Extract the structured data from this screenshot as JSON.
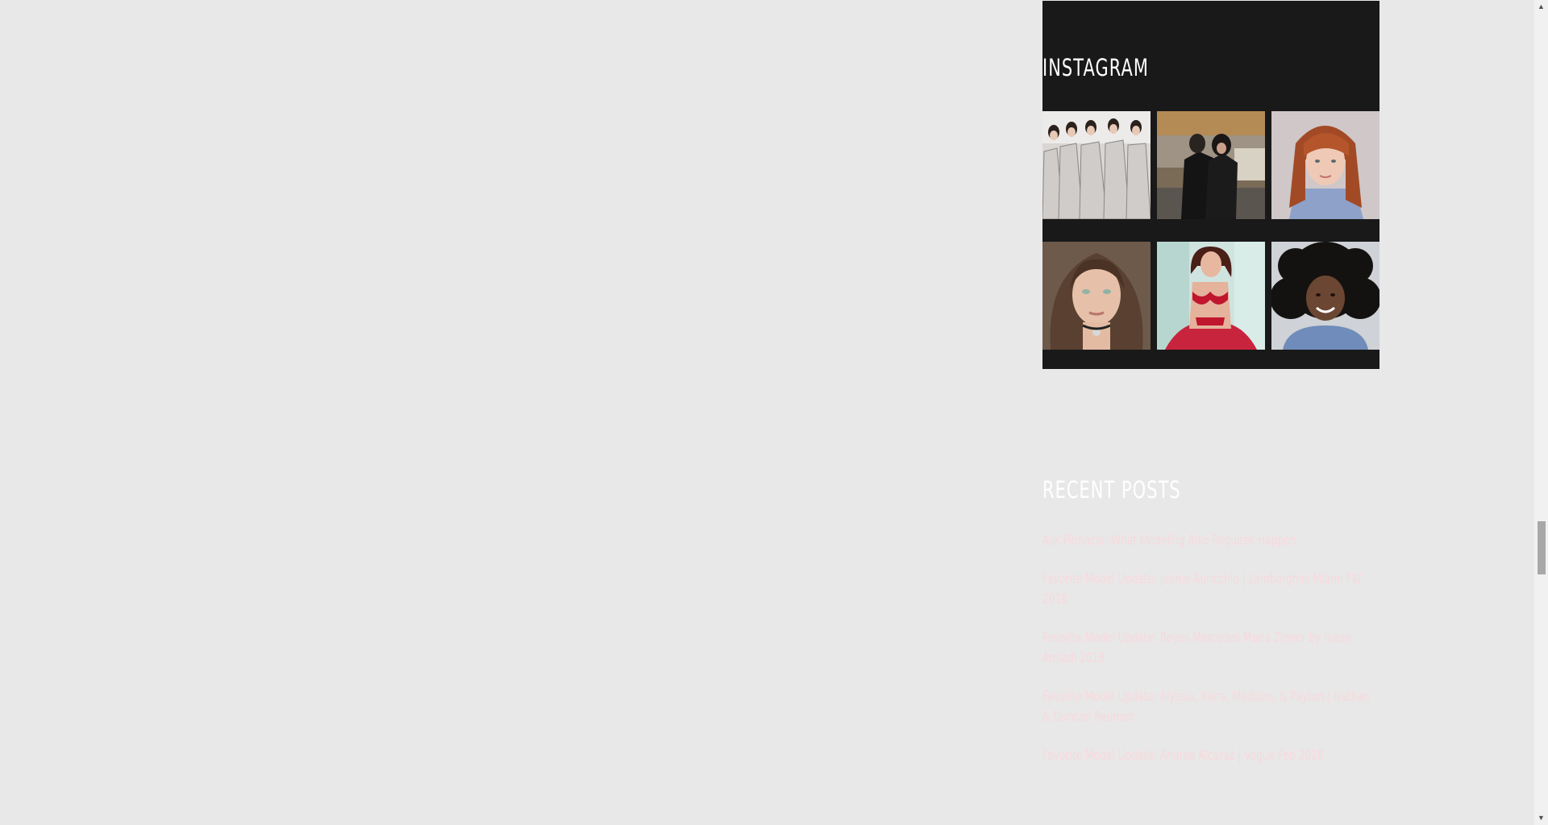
{
  "sidebar": {
    "instagram": {
      "title": "INSTAGRAM",
      "photos": [
        {
          "icon": "photo-group-white-dresses"
        },
        {
          "icon": "photo-couple-black-outfits"
        },
        {
          "icon": "photo-red-haired-girl"
        },
        {
          "icon": "photo-girl-green-eyes"
        },
        {
          "icon": "photo-model-red-lingerie"
        },
        {
          "icon": "photo-girl-curly-hair"
        }
      ]
    },
    "recent_posts": {
      "title": "RECENT POSTS",
      "items": [
        {
          "label": "Ask Pinnacle: What Modeling Also Requires Happen"
        },
        {
          "label": "Favorite Model Update: Joanie Auricchio | Lamborghini Miami FW 2018"
        },
        {
          "label": "Favorite Model Update: Reyes Mercedes Maria Zinner by Ivaan Amjadi 2018"
        },
        {
          "label": "Favorite Model Update: Alyssia, Kiera, Madison, & Payton | Nathan & Duncan Reunion"
        },
        {
          "label": "Favorite Model Update: Andrea Alcaraz | Vogue Feb 2018"
        }
      ]
    }
  },
  "colors": {
    "page_background": "#e8e8e8",
    "widget_background": "#191919",
    "title_color": "#ffffff",
    "link_color": "#f7d9dd"
  }
}
